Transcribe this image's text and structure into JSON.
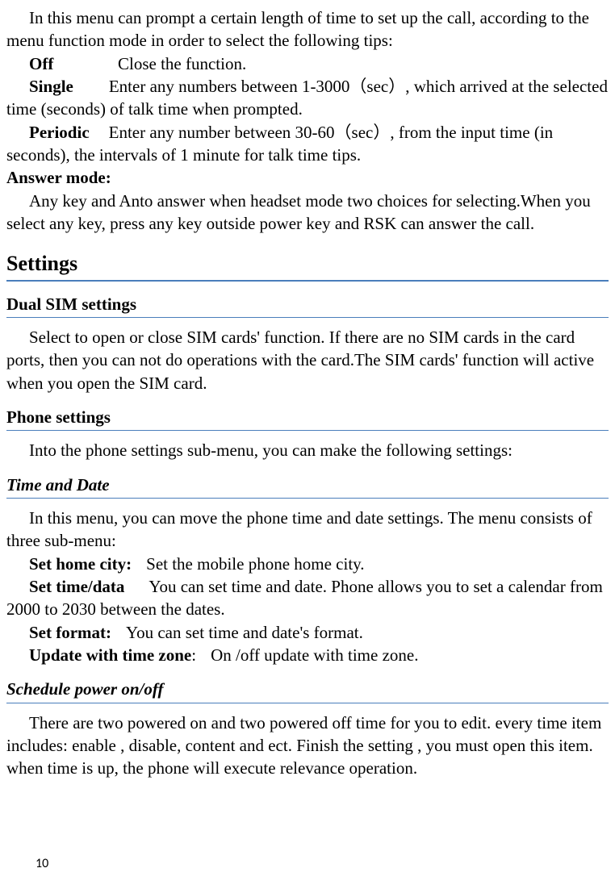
{
  "intro": "In this menu can prompt a certain length of time to set up the call, according to the menu function mode in order to select the following tips:",
  "off_label": "Off",
  "off_desc": "Close the function.",
  "single_label": "Single",
  "single_desc": "Enter any numbers between 1-3000（sec）, which arrived at the selected time (seconds) of talk time when prompted.",
  "periodic_label": "Periodic",
  "periodic_desc": "Enter any number between 30-60（sec）, from the input time (in seconds), the intervals of 1 minute for talk time tips.",
  "answer_mode_label": "Answer mode:",
  "answer_mode_desc": "Any key and Anto answer when headset mode two choices for selecting.When you select any key, press any key outside power key and RSK can answer the call.",
  "h1_settings": "Settings",
  "h2_dual": "Dual SIM settings",
  "dual_body": "Select to open or close SIM cards' function. If there are no SIM cards in the card ports, then you can not do operations with the card.The SIM cards' function will active when you open the SIM card.",
  "h2_phone": "Phone settings",
  "phone_body": "Into the phone settings sub-menu, you can make the following settings:",
  "h3_time": "Time and Date",
  "time_intro": "In this menu, you can move the phone time and date settings. The menu consists of three sub-menu:",
  "set_home_label": "Set home city:",
  "set_home_desc": "Set the mobile phone home city.",
  "set_time_label": "Set time/data",
  "set_time_desc": "You can set time and date. Phone allows you to set a calendar from 2000 to 2030 between the dates.",
  "set_format_label": "Set format:",
  "set_format_desc": "You can set time and date's format.",
  "update_tz_label": "Update with time zone",
  "update_tz_colon": ":",
  "update_tz_desc": "On /off update with time zone.",
  "h3_sched": "Schedule power on/off",
  "sched_body": "There are two powered on and two powered off time for you to edit. every time item includes: enable , disable, content and ect. Finish the setting , you must open this item. when time is up, the phone will execute relevance operation.",
  "page_number": "10"
}
